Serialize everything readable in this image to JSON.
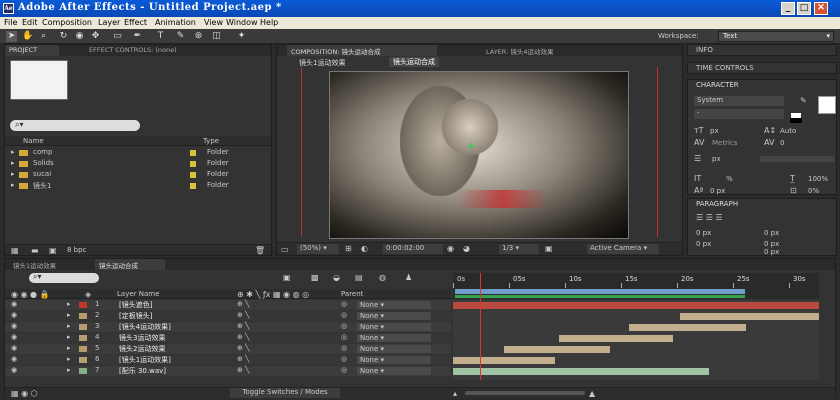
{
  "titlebar": {
    "title": "Adobe After Effects - Untitled Project.aep *",
    "min": "_",
    "max": "□",
    "close": "✕"
  },
  "menu": [
    "File",
    "Edit",
    "Composition",
    "Layer",
    "Effect",
    "Animation",
    "View",
    "Window",
    "Help"
  ],
  "toolbar": {
    "workspace_label": "Workspace:",
    "workspace_value": "Text"
  },
  "project": {
    "tab_project": "PROJECT",
    "tab_effects": "EFFECT CONTROLS: (none)",
    "search_placeholder": "",
    "col_name": "Name",
    "col_type": "Type",
    "items": [
      {
        "name": "comp",
        "type": "Folder"
      },
      {
        "name": "Solids",
        "type": "Folder"
      },
      {
        "name": "sucai",
        "type": "Folder"
      },
      {
        "name": "镜头1",
        "type": "Folder"
      }
    ],
    "bpc": "8 bpc"
  },
  "composition": {
    "tab_label": "COMPOSITION: 镜头运动合成",
    "layer_tab": "LAYER: 镜头4运动效果",
    "breadcrumb_1": "镜头1运动效果",
    "breadcrumb_2": "镜头运动合成",
    "zoom": "(50%)",
    "timecode": "0:00:02:00",
    "resolution": "1/3",
    "camera": "Active Camera"
  },
  "right": {
    "info": "INFO",
    "time_controls": "TIME CONTROLS",
    "character": "CHARACTER",
    "font": "System",
    "style": "-",
    "size_unit": "px",
    "leading": "Auto",
    "kerning_label": "Metrics",
    "tracking": "0",
    "stroke": "px",
    "vscale": "%",
    "hscale": "100%",
    "baseline": "0 px",
    "tsume": "0%",
    "paragraph": "PARAGRAPH",
    "indent1": "0 px",
    "indent2": "0 px",
    "indent3": "0 px",
    "indent4": "0 px",
    "indent5": "0 px"
  },
  "timeline": {
    "tab1": "镜头1运动效果",
    "tab2": "镜头运动合成",
    "col_layer_name": "Layer Name",
    "col_parent": "Parent",
    "toggle": "Toggle Switches / Modes",
    "ruler": [
      "0s",
      "05s",
      "10s",
      "15s",
      "20s",
      "25s",
      "30s"
    ],
    "layers": [
      {
        "num": "1",
        "name": "[镜头遮色]",
        "parent": "None",
        "color": "#c0392b",
        "start": 0.0,
        "end": 1.0,
        "bar": "#b84a40"
      },
      {
        "num": "2",
        "name": "[定板镜头]",
        "parent": "None",
        "color": "#b89a70",
        "start": 0.62,
        "end": 1.0,
        "bar": "#c2ad8c"
      },
      {
        "num": "3",
        "name": "[镜头4运动效果]",
        "parent": "None",
        "color": "#b89a70",
        "start": 0.48,
        "end": 0.8,
        "bar": "#c2ad8c"
      },
      {
        "num": "4",
        "name": "镜头3运动效果",
        "parent": "None",
        "color": "#b89a70",
        "start": 0.29,
        "end": 0.6,
        "bar": "#c2ad8c"
      },
      {
        "num": "5",
        "name": "镜头2运动效果",
        "parent": "None",
        "color": "#b89a70",
        "start": 0.14,
        "end": 0.43,
        "bar": "#c2ad8c"
      },
      {
        "num": "6",
        "name": "[镜头1运动效果]",
        "parent": "None",
        "color": "#b89a70",
        "start": 0.0,
        "end": 0.28,
        "bar": "#c2ad8c"
      },
      {
        "num": "7",
        "name": "[配乐 30.wav]",
        "parent": "None",
        "color": "#86b08a",
        "start": 0.0,
        "end": 0.7,
        "bar": "#9fc4a4"
      }
    ]
  }
}
